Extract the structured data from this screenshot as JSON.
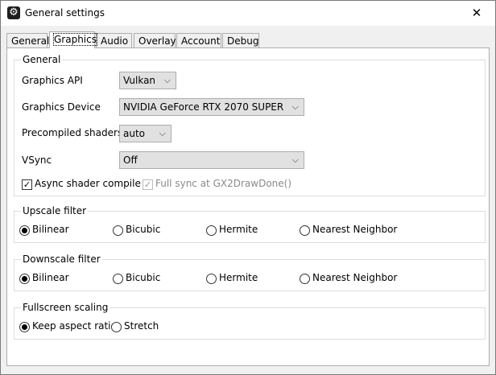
{
  "window": {
    "title": "General settings",
    "close_glyph": "✕",
    "app_icon": "gear-icon"
  },
  "tabs": [
    {
      "label": "General",
      "active": false
    },
    {
      "label": "Graphics",
      "active": true
    },
    {
      "label": "Audio",
      "active": false
    },
    {
      "label": "Overlay",
      "active": false
    },
    {
      "label": "Account",
      "active": false
    },
    {
      "label": "Debug",
      "active": false
    }
  ],
  "general": {
    "title": "General",
    "graphics_api": {
      "label": "Graphics API",
      "value": "Vulkan"
    },
    "graphics_device": {
      "label": "Graphics Device",
      "value": "NVIDIA GeForce RTX 2070 SUPER"
    },
    "precompiled_shaders": {
      "label": "Precompiled shaders",
      "value": "auto"
    },
    "vsync": {
      "label": "VSync",
      "value": "Off"
    },
    "async_shader": {
      "label": "Async shader compile",
      "checked": true
    },
    "full_sync": {
      "label": "Full sync at GX2DrawDone()",
      "checked": true,
      "enabled": false
    }
  },
  "upscale": {
    "title": "Upscale filter",
    "options": [
      "Bilinear",
      "Bicubic",
      "Hermite",
      "Nearest Neighbor"
    ],
    "selected": "Bilinear"
  },
  "downscale": {
    "title": "Downscale filter",
    "options": [
      "Bilinear",
      "Bicubic",
      "Hermite",
      "Nearest Neighbor"
    ],
    "selected": "Bilinear"
  },
  "fullscreen": {
    "title": "Fullscreen scaling",
    "options": [
      "Keep aspect ratio",
      "Stretch"
    ],
    "selected": "Keep aspect ratio"
  },
  "colors": {
    "window_bg": "#f0f0f0",
    "panel_bg": "#ffffff",
    "border": "#adadad"
  }
}
